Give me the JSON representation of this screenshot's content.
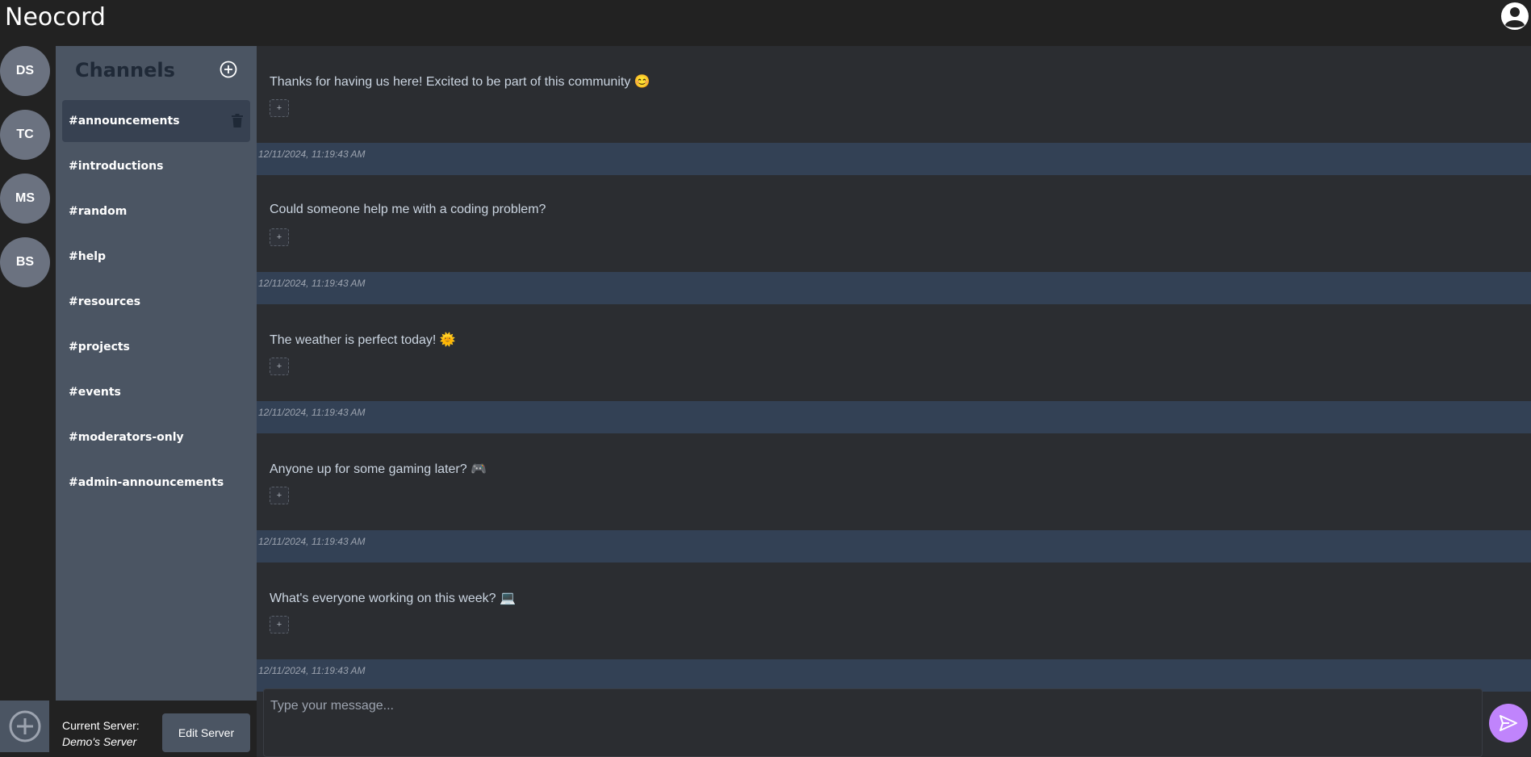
{
  "app": {
    "title": "Neocord"
  },
  "servers": [
    {
      "initials": "DS"
    },
    {
      "initials": "TC"
    },
    {
      "initials": "MS"
    },
    {
      "initials": "BS"
    }
  ],
  "channels_panel": {
    "title": "Channels",
    "channels": [
      {
        "label": "#announcements",
        "active": true
      },
      {
        "label": "#introductions"
      },
      {
        "label": "#random"
      },
      {
        "label": "#help"
      },
      {
        "label": "#resources"
      },
      {
        "label": "#projects"
      },
      {
        "label": "#events"
      },
      {
        "label": "#moderators-only"
      },
      {
        "label": "#admin-announcements"
      }
    ]
  },
  "server_info": {
    "current_label": "Current Server:",
    "current_name": "Demo's Server",
    "edit_label": "Edit Server"
  },
  "messages": [
    {
      "text": "Thanks for having us here! Excited to be part of this community 😊",
      "reaction": "+",
      "timestamp": "12/11/2024, 11:19:43 AM"
    },
    {
      "text": "Could someone help me with a coding problem?",
      "reaction": "+",
      "timestamp": "12/11/2024, 11:19:43 AM"
    },
    {
      "text": "The weather is perfect today! 🌞",
      "reaction": "+",
      "timestamp": "12/11/2024, 11:19:43 AM"
    },
    {
      "text": "Anyone up for some gaming later? 🎮",
      "reaction": "+",
      "timestamp": "12/11/2024, 11:19:43 AM"
    },
    {
      "text": "What's everyone working on this week? 💻",
      "reaction": "+",
      "timestamp": "12/11/2024, 11:19:43 AM"
    }
  ],
  "composer": {
    "placeholder": "Type your message..."
  },
  "icons": {
    "profile": "user-circle-icon",
    "add_channel": "plus-circle-icon",
    "delete_channel": "trash-icon",
    "add_server": "plus-circle-icon",
    "send": "send-icon"
  },
  "colors": {
    "background": "#222222",
    "channels_panel": "#4b5563",
    "active_channel": "#374151",
    "message_bg": "#2b2d31",
    "timestamp_bar": "#334155",
    "send_button": "#c084fc",
    "server_avatar": "#6b7280"
  }
}
